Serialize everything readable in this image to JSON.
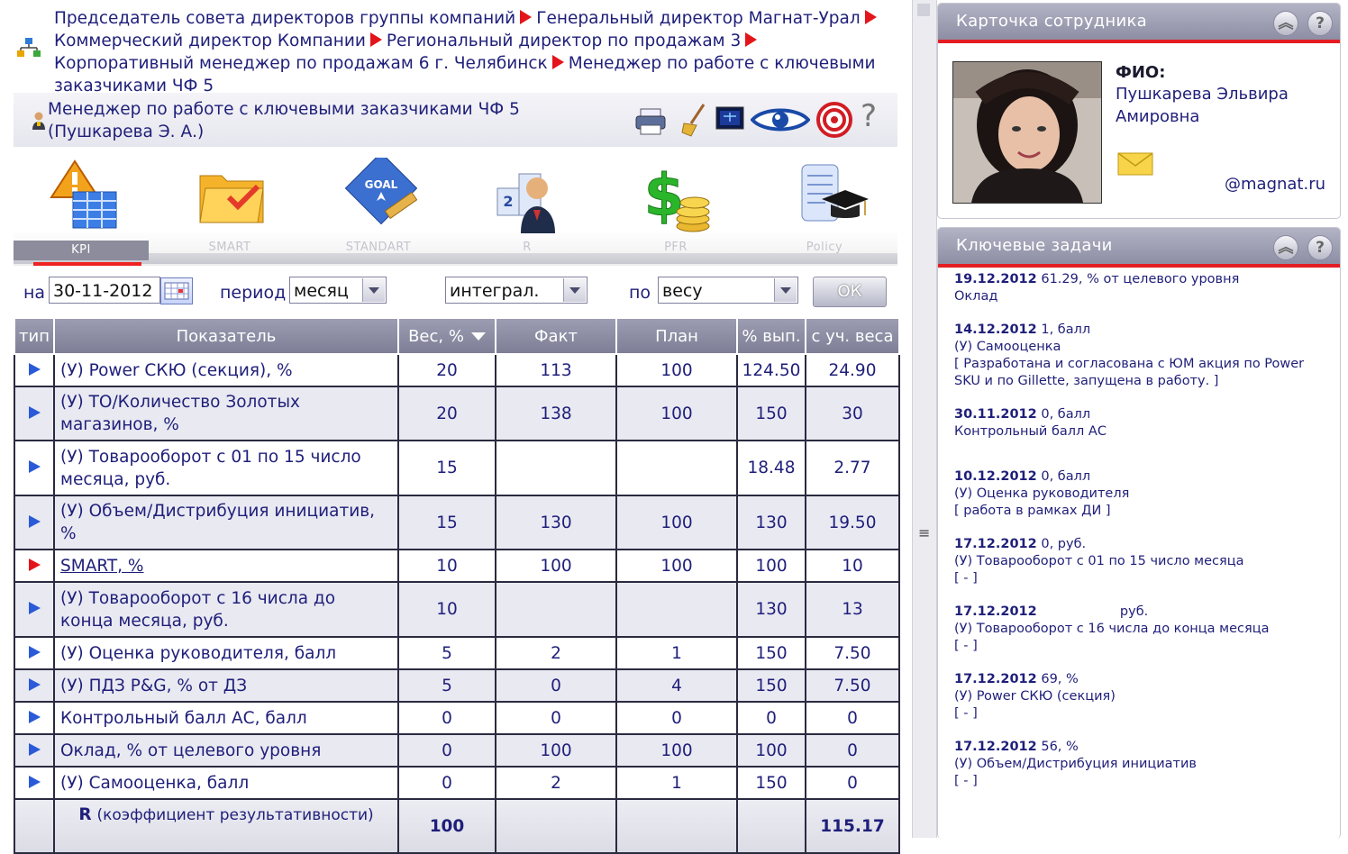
{
  "breadcrumb": {
    "items": [
      "Председатель совета директоров группы компаний",
      "Генеральный директор Магнат-Урал",
      "Коммерческий директор Компании",
      "Региональный директор по продажам 3",
      "Корпоративный менеджер по продажам 6 г. Челябинск",
      "Менеджер по работе с ключевыми заказчиками ЧФ 5"
    ]
  },
  "header": {
    "title": "Менеджер по работе с ключевыми заказчиками ЧФ 5  (Пушкарева Э. А.)",
    "tools": [
      "print-icon",
      "broom-icon",
      "monitor-icon",
      "eye-icon",
      "target-icon",
      "help-icon"
    ],
    "help_char": "?"
  },
  "modules": [
    {
      "label": "KPI",
      "icon": "kpi-icon",
      "active": true
    },
    {
      "label": "SMART",
      "icon": "smart-folder-icon"
    },
    {
      "label": "STANDART",
      "icon": "goal-icon"
    },
    {
      "label": "R",
      "icon": "rating-icon"
    },
    {
      "label": "PFR",
      "icon": "money-icon"
    },
    {
      "label": "Policy",
      "icon": "policy-icon"
    }
  ],
  "filters": {
    "date_label": "на",
    "date_value": "30-11-2012",
    "period_label": "период",
    "period_value": "месяц",
    "mode_value": "интеграл.",
    "by_label": "по",
    "by_value": "весу",
    "ok_label": "ОК"
  },
  "table": {
    "headers": [
      "тип",
      "Показатель",
      "Вес, %",
      "Факт",
      "План",
      "% вып.",
      "с уч. веса"
    ],
    "rows": [
      {
        "type": "blue",
        "name": "(У) Power СКЮ (секция), %",
        "weight": "20",
        "fact": "113",
        "plan": "100",
        "pct": "124.50",
        "weighted": "24.90"
      },
      {
        "type": "blue",
        "name": "(У) ТО/Количество Золотых магазинов, %",
        "weight": "20",
        "fact": "138",
        "plan": "100",
        "pct": "150",
        "weighted": "30"
      },
      {
        "type": "blue",
        "name": "(У) Товарооборот с 01 по 15 число месяца, руб.",
        "weight": "15",
        "fact": "",
        "plan": "",
        "pct": "18.48",
        "weighted": "2.77"
      },
      {
        "type": "blue",
        "name": "(У) Объем/Дистрибуция инициатив, %",
        "weight": "15",
        "fact": "130",
        "plan": "100",
        "pct": "130",
        "weighted": "19.50"
      },
      {
        "type": "red",
        "name": "SMART, %",
        "weight": "10",
        "fact": "100",
        "plan": "100",
        "pct": "100",
        "weighted": "10",
        "link": true
      },
      {
        "type": "blue",
        "name": "(У) Товарооборот с 16 числа до конца месяца, руб.",
        "weight": "10",
        "fact": "",
        "plan": "",
        "pct": "130",
        "weighted": "13"
      },
      {
        "type": "blue",
        "name": "(У) Оценка руководителя, балл",
        "weight": "5",
        "fact": "2",
        "plan": "1",
        "pct": "150",
        "weighted": "7.50"
      },
      {
        "type": "blue",
        "name": "(У) ПДЗ P&G, % от ДЗ",
        "weight": "5",
        "fact": "0",
        "plan": "4",
        "pct": "150",
        "weighted": "7.50"
      },
      {
        "type": "blue",
        "name": "Контрольный балл АС, балл",
        "weight": "0",
        "fact": "0",
        "plan": "0",
        "pct": "0",
        "weighted": "0"
      },
      {
        "type": "blue",
        "name": "Оклад, % от целевого уровня",
        "weight": "0",
        "fact": "100",
        "plan": "100",
        "pct": "100",
        "weighted": "0"
      },
      {
        "type": "blue",
        "name": "(У) Самооценка, балл",
        "weight": "0",
        "fact": "2",
        "plan": "1",
        "pct": "150",
        "weighted": "0"
      }
    ],
    "total": {
      "r": "R",
      "label": "(коэффициент результативности)",
      "weight": "100",
      "weighted": "115.17"
    }
  },
  "card": {
    "title": "Карточка сотрудника",
    "fio_label": "ФИО:",
    "fio_name": "Пушкарева Эльвира Амировна",
    "email": "@magnat.ru"
  },
  "tasks_panel": {
    "title": "Ключевые задачи",
    "items": [
      {
        "date": "19.12.2012",
        "value": " 61.29, % от целевого уровня",
        "lines": [
          "Оклад"
        ]
      },
      {
        "date": "14.12.2012",
        "value": " 1, балл",
        "lines": [
          "(У) Самооценка",
          "[ Разработана и согласована с ЮМ акция по Power SKU и по Gillette, запущена в работу. ]"
        ]
      },
      {
        "date": "30.11.2012",
        "value": " 0, балл",
        "lines": [
          "Контрольный балл АС"
        ]
      },
      {
        "date": "10.12.2012",
        "value": " 0, балл",
        "lines": [
          "(У) Оценка руководителя",
          "[ работа в рамках ДИ ]"
        ]
      },
      {
        "date": "17.12.2012",
        "value": " 0, руб.",
        "lines": [
          "(У) Товарооборот с 01 по 15 число месяца",
          "[ - ]"
        ]
      },
      {
        "date": "17.12.2012",
        "value": "                    руб.",
        "lines": [
          "(У) Товарооборот с 16 числа до конца месяца",
          "[ - ]"
        ]
      },
      {
        "date": "17.12.2012",
        "value": " 69, %",
        "lines": [
          "(У) Power СКЮ (секция)",
          "[ - ]"
        ]
      },
      {
        "date": "17.12.2012",
        "value": " 56, %",
        "lines": [
          "(У) Объем/Дистрибуция инициатив",
          "[ - ]"
        ]
      }
    ]
  }
}
